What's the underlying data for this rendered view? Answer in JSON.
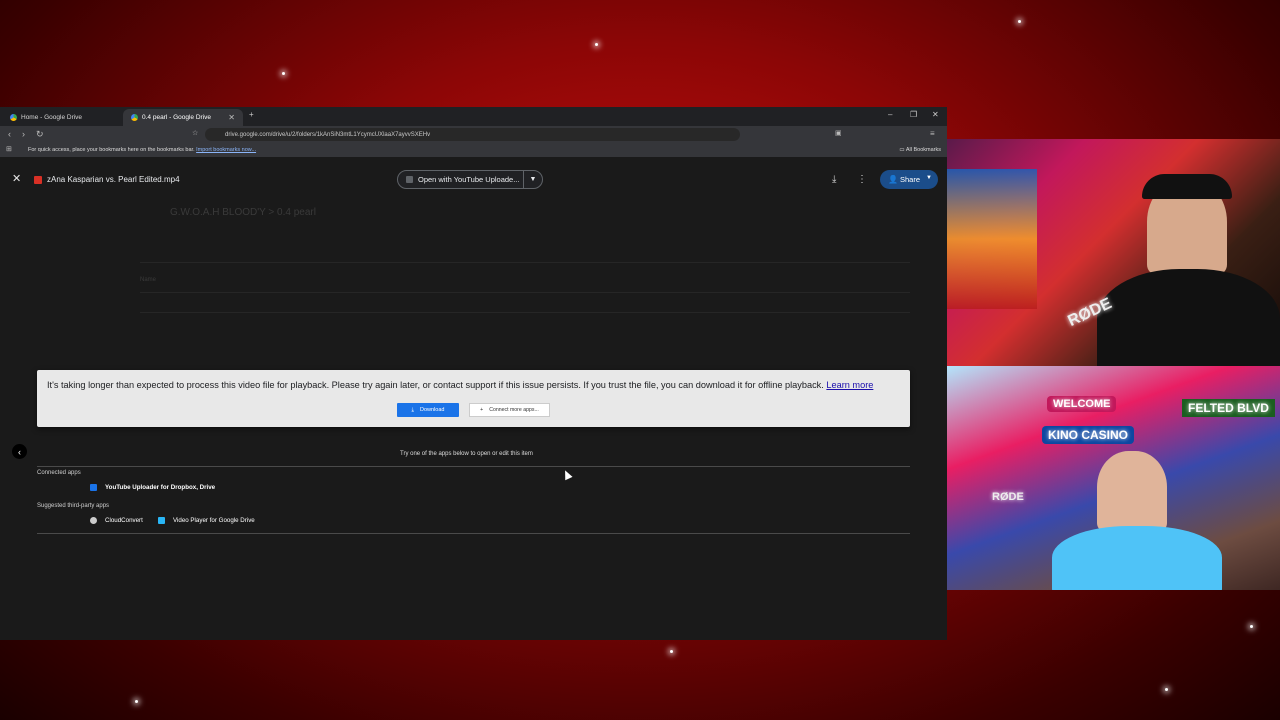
{
  "browser": {
    "tabs": [
      {
        "label": "Home - Google Drive",
        "active": false
      },
      {
        "label": "0.4 pearl - Google Drive",
        "active": true
      }
    ],
    "url": "drive.google.com/drive/u/2/folders/1kAnSiN3mtL1YcymcUXlaaX7ayvvSXEHv",
    "bookmark_bar": {
      "prompt": "For quick access, place your bookmarks here on the bookmarks bar.",
      "import_link": "Import bookmarks now...",
      "all_bookmarks": "All Bookmarks"
    }
  },
  "viewer": {
    "file_name": "zAna Kasparian vs. Pearl Edited.mp4",
    "open_with": "Open with YouTube Uploade...",
    "share_label": "Share",
    "message": "It's taking longer than expected to process this video file for playback. Please try again later, or contact support if this issue persists. If you trust the file, you can download it for offline playback.",
    "learn_more": "Learn more",
    "download_label": "Download",
    "connect_label": "Connect more apps...",
    "try_text": "Try one of the apps below to open or edit this item",
    "connected_heading": "Connected apps",
    "connected_apps": [
      "YouTube Uploader for Dropbox, Drive"
    ],
    "suggested_heading": "Suggested third-party apps",
    "suggested_apps": [
      "CloudConvert",
      "Video Player for Google Drive"
    ]
  },
  "background_ghost": {
    "breadcrumb": "G.W.O.A.H BLOOD'Y  >  0.4 pearl",
    "header_name": "Name"
  },
  "stream": {
    "mic_brand": "RØDE",
    "sign_welcome": "WELCOME",
    "sign_casino": "KINO CASINO",
    "sign_street": "FELTED BLVD"
  },
  "colors": {
    "share_blue": "#1b4d8a",
    "download_blue": "#1a73e8",
    "bg_red": "#c8100e"
  }
}
